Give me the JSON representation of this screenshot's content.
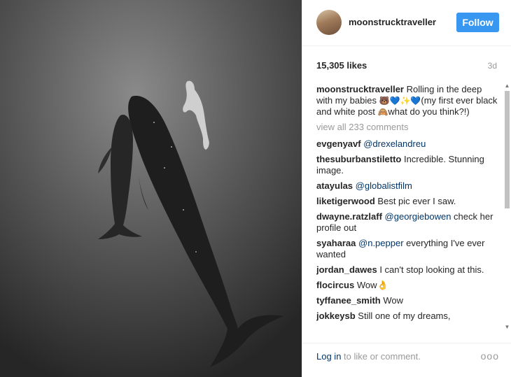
{
  "post": {
    "username": "moonstrucktraveller",
    "follow_label": "Follow",
    "likes": "15,305 likes",
    "time_ago": "3d",
    "caption_user": "moonstrucktraveller",
    "caption_text_1": "Rolling in the deep with my babies ",
    "caption_emoji_1": "🐻💙✨💙",
    "caption_text_2": "(my first ever black and white post ",
    "caption_emoji_2": "🙈",
    "caption_text_3": "what do you think?!)",
    "view_all": "view all 233 comments"
  },
  "comments": [
    {
      "user": "evgenyavf",
      "mention": "@drexelandreu",
      "text": ""
    },
    {
      "user": "thesuburbanstiletto",
      "mention": "",
      "text": "Incredible. Stunning image."
    },
    {
      "user": "atayulas",
      "mention": "@globalistfilm",
      "text": ""
    },
    {
      "user": "liketigerwood",
      "mention": "",
      "text": "Best pic ever I saw."
    },
    {
      "user": "dwayne.ratzlaff",
      "mention": "@georgiebowen",
      "text": "check her profile out"
    },
    {
      "user": "syaharaa",
      "mention": "@n.pepper",
      "text": "everything I've ever wanted"
    },
    {
      "user": "jordan_dawes",
      "mention": "",
      "text": "I can't stop looking at this."
    },
    {
      "user": "flocircus",
      "mention": "",
      "text": "Wow👌"
    },
    {
      "user": "tyffanee_smith",
      "mention": "",
      "text": "Wow"
    },
    {
      "user": "jokkeysb",
      "mention": "",
      "text": "Still one of my dreams,"
    }
  ],
  "footer": {
    "login_label": "Log in",
    "login_suffix": " to like or comment.",
    "more_label": "ooo"
  },
  "colors": {
    "follow_button": "#3897f0",
    "link": "#003569",
    "muted": "#999999"
  }
}
